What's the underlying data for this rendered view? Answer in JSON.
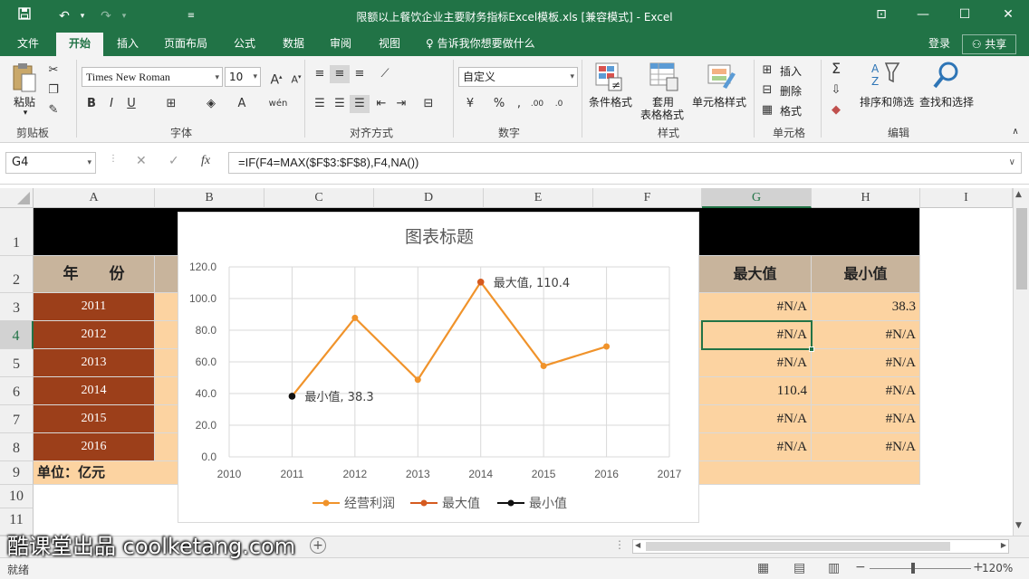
{
  "window": {
    "title": "限额以上餐饮企业主要财务指标Excel模板.xls  [兼容模式] - Excel",
    "save_icon": "save-icon",
    "minimize": "—",
    "maximize": "☐",
    "close": "✕",
    "ribbon_display": "⊡"
  },
  "tabs": [
    {
      "label": "文件"
    },
    {
      "label": "开始"
    },
    {
      "label": "插入"
    },
    {
      "label": "页面布局"
    },
    {
      "label": "公式"
    },
    {
      "label": "数据"
    },
    {
      "label": "审阅"
    },
    {
      "label": "视图"
    }
  ],
  "tell_me": "告诉我你想要做什么",
  "login": "登录",
  "share": "共享",
  "ribbon": {
    "paste": "粘贴",
    "font_name": "Times New Roman",
    "font_size": "10",
    "number_format": "自定义",
    "conditional_format": "条件格式",
    "format_as_table_1": "套用",
    "format_as_table_2": "表格格式",
    "cell_styles": "单元格样式",
    "insert": "插入",
    "delete": "删除",
    "format": "格式",
    "sort_filter": "排序和筛选",
    "find_select": "查找和选择",
    "groups": {
      "clipboard": "剪贴板",
      "font": "字体",
      "alignment": "对齐方式",
      "number": "数字",
      "styles": "样式",
      "cells": "单元格",
      "editing": "编辑"
    }
  },
  "formula_bar": {
    "name_box": "G4",
    "formula": "=IF(F4=MAX($F$3:$F$8),F4,NA())"
  },
  "columns": [
    "A",
    "B",
    "C",
    "D",
    "E",
    "F",
    "G",
    "H",
    "I"
  ],
  "rows": [
    "1",
    "2",
    "3",
    "4",
    "5",
    "6",
    "7",
    "8",
    "9",
    "10",
    "11"
  ],
  "sheet": {
    "header_year": "年　　份",
    "header_max": "最大值",
    "header_min": "最小值",
    "years": [
      "2011",
      "2012",
      "2013",
      "2014",
      "2015",
      "2016"
    ],
    "max_col": [
      "#N/A",
      "#N/A",
      "#N/A",
      "110.4",
      "#N/A",
      "#N/A"
    ],
    "min_col": [
      "38.3",
      "#N/A",
      "#N/A",
      "#N/A",
      "#N/A",
      "#N/A"
    ],
    "unit": "单位：亿元"
  },
  "chart_data": {
    "type": "line",
    "title": "图表标题",
    "x": [
      2011,
      2012,
      2013,
      2014,
      2015,
      2016
    ],
    "xlim": [
      2010,
      2017
    ],
    "xticks": [
      "2010",
      "2011",
      "2012",
      "2013",
      "2014",
      "2015",
      "2016",
      "2017"
    ],
    "ylim": [
      0,
      120
    ],
    "yticks": [
      "0.0",
      "20.0",
      "40.0",
      "60.0",
      "80.0",
      "100.0",
      "120.0"
    ],
    "grid": true,
    "legend": "bottom",
    "series": [
      {
        "name": "经营利润",
        "values": [
          38.3,
          87.8,
          48.7,
          110.4,
          57.4,
          69.7
        ],
        "color": "#f0932b"
      },
      {
        "name": "最大值",
        "values": [
          null,
          null,
          null,
          110.4,
          null,
          null
        ],
        "color": "#d55a1f"
      },
      {
        "name": "最小值",
        "values": [
          38.3,
          null,
          null,
          null,
          null,
          null
        ],
        "color": "#111111"
      }
    ],
    "annotations": [
      {
        "text": "最大值, 110.4",
        "x": 2014,
        "y": 110.4
      },
      {
        "text": "最小值, 38.3",
        "x": 2011,
        "y": 38.3
      }
    ]
  },
  "status": {
    "ready": "就绪",
    "zoom": "120%"
  },
  "watermark": "酷课堂出品 coolketang.com",
  "colors": {
    "excel_green": "#217346",
    "year_cell": "#9c3f1a",
    "header_cell": "#c8b49c",
    "data_cell": "#fcd3a1",
    "black_band": "#000000"
  }
}
